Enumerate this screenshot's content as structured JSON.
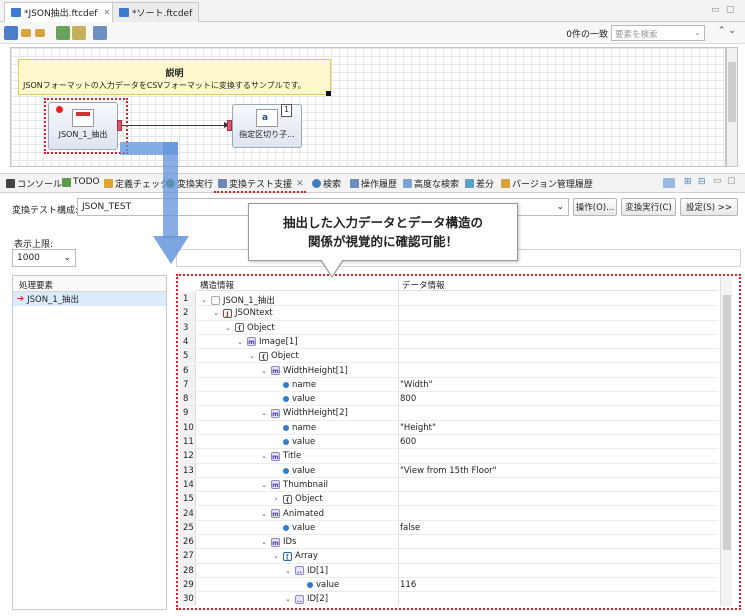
{
  "editor_tabs": [
    {
      "label": "*JSON抽出.ftcdef",
      "active": true
    },
    {
      "label": "*ソート.ftcdef",
      "active": false
    }
  ],
  "toolbar": {
    "match_count": "0件の一致",
    "search_placeholder": "要素を検索"
  },
  "canvas": {
    "note_title": "説明",
    "note_body": "JSONフォーマットの入力データをCSVフォーマットに変換するサンプルです。",
    "node1_label": "JSON_1_抽出",
    "node2_label": "指定区切り子...",
    "node2_badge": "1"
  },
  "view_tabs": [
    "コンソール",
    "TODO",
    "定義チェック",
    "変換実行",
    "変換テスト支援",
    "検索",
    "操作履歴",
    "高度な検索",
    "差分",
    "バージョン管理履歴"
  ],
  "config": {
    "label": "変換テスト構成:",
    "value": "JSON_TEST",
    "operate_btn": "操作(O)...",
    "run_btn": "変換実行(C)",
    "settings_btn": "設定(S) >>",
    "limit_label": "表示上限:",
    "limit_value": "1000"
  },
  "left_panel": {
    "header": "処理要素",
    "item": "JSON_1_抽出"
  },
  "tree": {
    "col_struct": "構造情報",
    "col_data": "データ情報",
    "rows": [
      {
        "n": "1",
        "label": "JSON_1_抽出",
        "data": ""
      },
      {
        "n": "2",
        "label": "JSONtext",
        "data": ""
      },
      {
        "n": "3",
        "label": "Object",
        "data": ""
      },
      {
        "n": "4",
        "label": "Image[1]",
        "data": ""
      },
      {
        "n": "5",
        "label": "Object",
        "data": ""
      },
      {
        "n": "6",
        "label": "WidthHeight[1]",
        "data": ""
      },
      {
        "n": "7",
        "label": "name",
        "data": "\"Width\""
      },
      {
        "n": "8",
        "label": "value",
        "data": "800"
      },
      {
        "n": "9",
        "label": "WidthHeight[2]",
        "data": ""
      },
      {
        "n": "10",
        "label": "name",
        "data": "\"Height\""
      },
      {
        "n": "11",
        "label": "value",
        "data": "600"
      },
      {
        "n": "12",
        "label": "Title",
        "data": ""
      },
      {
        "n": "13",
        "label": "value",
        "data": "\"View from 15th Floor\""
      },
      {
        "n": "14",
        "label": "Thumbnail",
        "data": ""
      },
      {
        "n": "15",
        "label": "Object",
        "data": ""
      },
      {
        "n": "24",
        "label": "Animated",
        "data": ""
      },
      {
        "n": "25",
        "label": "value",
        "data": "false"
      },
      {
        "n": "26",
        "label": "IDs",
        "data": ""
      },
      {
        "n": "27",
        "label": "Array",
        "data": ""
      },
      {
        "n": "28",
        "label": "ID[1]",
        "data": ""
      },
      {
        "n": "29",
        "label": "value",
        "data": "116"
      },
      {
        "n": "30",
        "label": "ID[2]",
        "data": ""
      }
    ]
  },
  "callout": {
    "line1": "抽出した入力データとデータ構造の",
    "line2": "関係が視覚的に確認可能！"
  },
  "colors": {
    "annotation_red": "#d62222",
    "arrow_blue": "#6496dc",
    "note_yellow": "#fff8cc"
  }
}
